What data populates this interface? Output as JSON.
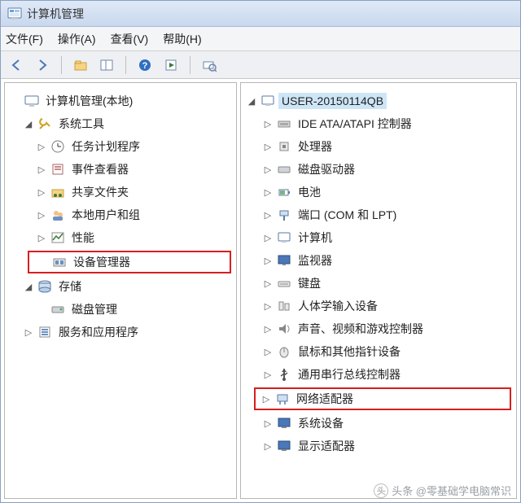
{
  "title": "计算机管理",
  "menus": {
    "file": "文件(F)",
    "action": "操作(A)",
    "view": "查看(V)",
    "help": "帮助(H)"
  },
  "left": {
    "root": "计算机管理(本地)",
    "sysTools": "系统工具",
    "taskScheduler": "任务计划程序",
    "eventViewer": "事件查看器",
    "sharedFolders": "共享文件夹",
    "localUsers": "本地用户和组",
    "performance": "性能",
    "deviceManager": "设备管理器",
    "storage": "存储",
    "diskMgmt": "磁盘管理",
    "servicesApps": "服务和应用程序"
  },
  "right": {
    "computer": "USER-20150114QB",
    "ide": "IDE ATA/ATAPI 控制器",
    "cpu": "处理器",
    "disk": "磁盘驱动器",
    "battery": "电池",
    "port": "端口 (COM 和 LPT)",
    "pc": "计算机",
    "monitor": "监视器",
    "keyboard": "键盘",
    "hid": "人体学输入设备",
    "sound": "声音、视频和游戏控制器",
    "mouse": "鼠标和其他指针设备",
    "usb": "通用串行总线控制器",
    "network": "网络适配器",
    "system": "系统设备",
    "display": "显示适配器"
  },
  "watermark": "头条 @零基础学电脑常识"
}
